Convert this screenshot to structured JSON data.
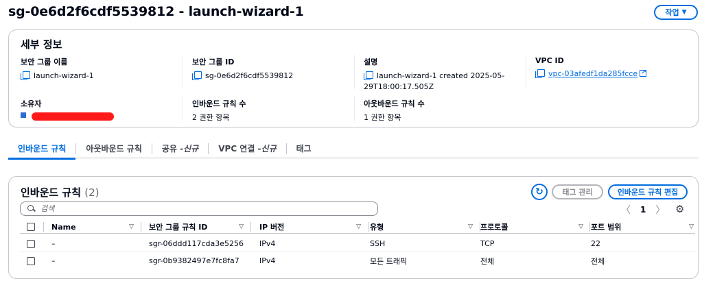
{
  "header": {
    "title": "sg-0e6d2f6cdf5539812 - launch-wizard-1",
    "action_label": "작업"
  },
  "details": {
    "title": "세부 정보",
    "sg_name_label": "보안 그룹 이름",
    "sg_name": "launch-wizard-1",
    "sg_id_label": "보안 그룹 ID",
    "sg_id": "sg-0e6d2f6cdf5539812",
    "desc_label": "설명",
    "desc_line1": "launch-wizard-1 created 2025-05-",
    "desc_line2": "29T18:00:17.505Z",
    "vpc_label": "VPC ID",
    "vpc_id": "vpc-03afedf1da285fcce",
    "owner_label": "소유자",
    "inbound_count_label": "인바운드 규칙 수",
    "inbound_count": "2 권한 항목",
    "outbound_count_label": "아웃바운드 규칙 수",
    "outbound_count": "1 권한 항목"
  },
  "tabs": [
    {
      "label": "인바운드 규칙",
      "suffix": ""
    },
    {
      "label": "아웃바운드 규칙",
      "suffix": ""
    },
    {
      "label": "공유 - ",
      "suffix": "신규"
    },
    {
      "label": "VPC 연결 - ",
      "suffix": "신규"
    },
    {
      "label": "태그",
      "suffix": ""
    }
  ],
  "rules": {
    "title": "인바운드 규칙",
    "count": "(2)",
    "tag_btn": "태그 관리",
    "edit_btn": "인바운드 규칙 편집",
    "search_placeholder": "검색",
    "page": "1",
    "columns": [
      "Name",
      "보안 그룹 규칙 ID",
      "IP 버전",
      "유형",
      "프로토콜",
      "포트 범위"
    ],
    "rows": [
      {
        "name": "–",
        "rule_id": "sgr-06ddd117cda3e5256",
        "ip": "IPv4",
        "type": "SSH",
        "protocol": "TCP",
        "port": "22"
      },
      {
        "name": "–",
        "rule_id": "sgr-0b9382497e7fc8fa7",
        "ip": "IPv4",
        "type": "모든 트래픽",
        "protocol": "전체",
        "port": "전체"
      }
    ]
  },
  "colors": {
    "accent": "#006ce0",
    "text": "#000716",
    "border": "#c6c6cd",
    "redaction": "#ff1a1a"
  }
}
